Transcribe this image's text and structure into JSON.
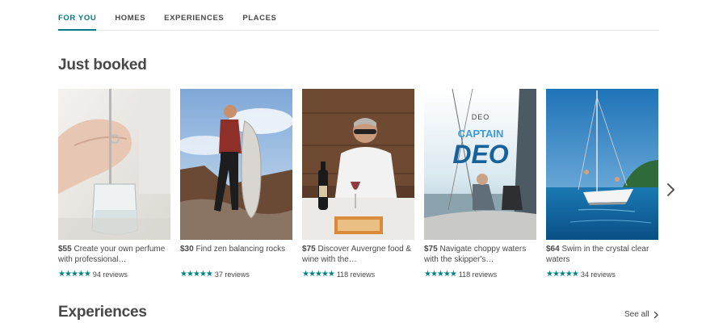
{
  "tabs": [
    {
      "label": "FOR YOU",
      "active": true
    },
    {
      "label": "HOMES",
      "active": false
    },
    {
      "label": "EXPERIENCES",
      "active": false
    },
    {
      "label": "PLACES",
      "active": false
    }
  ],
  "just_booked": {
    "title": "Just booked",
    "cards": [
      {
        "price": "$55",
        "text": "Create your own perfume with professional…",
        "stars": "★★★★★",
        "reviews": "94 reviews"
      },
      {
        "price": "$30",
        "text": "Find zen balancing rocks",
        "stars": "★★★★★",
        "reviews": "37 reviews"
      },
      {
        "price": "$75",
        "text": "Discover Auvergne food & wine with the…",
        "stars": "★★★★★",
        "reviews": "118 reviews"
      },
      {
        "price": "$75",
        "text": "Navigate choppy waters with the skipper's…",
        "stars": "★★★★★",
        "reviews": "118 reviews"
      },
      {
        "price": "$64",
        "text": "Swim in the crystal clear waters",
        "stars": "★★★★★",
        "reviews": "34 reviews"
      }
    ]
  },
  "experiences": {
    "title": "Experiences",
    "see_all": "See all"
  },
  "image_text": {
    "deo_small": "DEO",
    "deo_captain": "CAPTAIN",
    "deo_big": "DEO"
  },
  "colors": {
    "accent": "#007a87",
    "star": "#008489",
    "text": "#484848"
  }
}
